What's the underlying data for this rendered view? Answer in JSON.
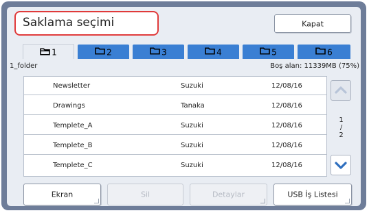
{
  "header": {
    "title": "Saklama seçimi",
    "close_label": "Kapat"
  },
  "tabs": [
    {
      "label": "1",
      "active": true
    },
    {
      "label": "2",
      "active": false
    },
    {
      "label": "3",
      "active": false
    },
    {
      "label": "4",
      "active": false
    },
    {
      "label": "5",
      "active": false
    },
    {
      "label": "6",
      "active": false
    }
  ],
  "folder": {
    "name": "1_folder",
    "free_space": "Boş alan: 11339MB (75%)"
  },
  "files": [
    {
      "name": "Newsletter",
      "owner": "Suzuki",
      "date": "12/08/16"
    },
    {
      "name": "Drawings",
      "owner": "Tanaka",
      "date": "12/08/16"
    },
    {
      "name": "Templete_A",
      "owner": "Suzuki",
      "date": "12/08/16"
    },
    {
      "name": "Templete_B",
      "owner": "Suzuki",
      "date": "12/08/16"
    },
    {
      "name": "Templete_C",
      "owner": "Suzuki",
      "date": "12/08/16"
    }
  ],
  "pager": {
    "current": "1",
    "sep": "/",
    "total": "2"
  },
  "buttons": {
    "screen": "Ekran",
    "delete": "Sil",
    "details": "Detaylar",
    "usb_list": "USB İş Listesi"
  },
  "colors": {
    "tab_blue": "#3a7fd3",
    "highlight_red": "#e03a3a",
    "frame": "#6e7d99",
    "arrow_blue": "#2f6fbf"
  },
  "icons": {
    "tab": "folder-icon",
    "scroll_up": "chevron-up-icon",
    "scroll_down": "chevron-down-icon"
  }
}
